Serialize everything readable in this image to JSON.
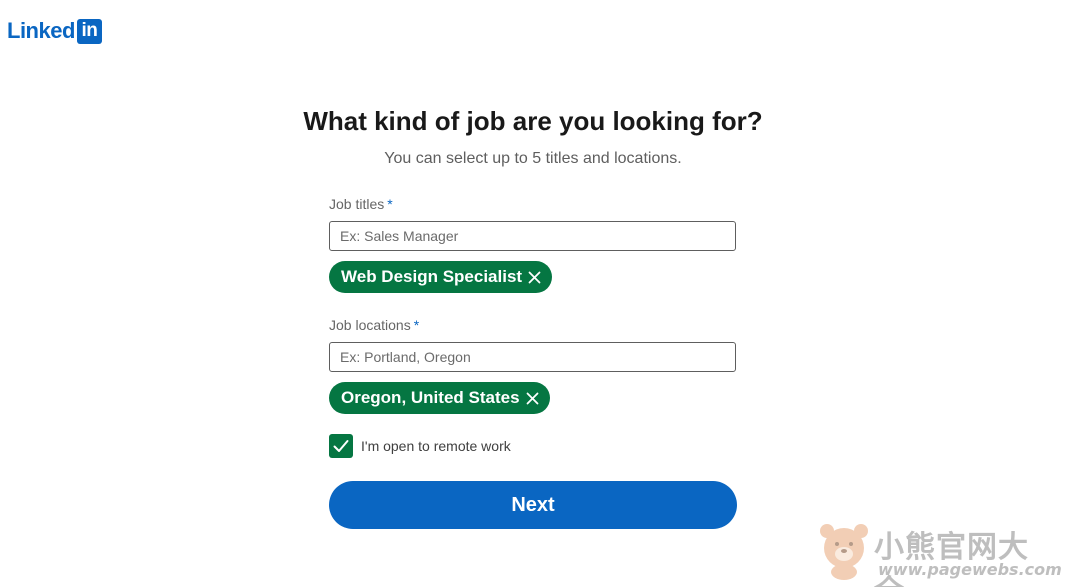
{
  "logo": {
    "word": "Linked",
    "box": "in"
  },
  "heading": "What kind of job are you looking for?",
  "subheading": "You can select up to 5 titles and locations.",
  "job_titles": {
    "label": "Job titles",
    "required_mark": "*",
    "placeholder": "Ex: Sales Manager",
    "value": "",
    "selected": [
      "Web Design Specialist"
    ]
  },
  "job_locations": {
    "label": "Job locations",
    "required_mark": "*",
    "placeholder": "Ex: Portland, Oregon",
    "value": "",
    "selected": [
      "Oregon, United States"
    ]
  },
  "remote": {
    "label": "I'm open to remote work",
    "checked": true
  },
  "next_label": "Next",
  "watermark": {
    "title": "小熊官网大全",
    "url": "www.pagewebs.com"
  },
  "colors": {
    "brand": "#0a66c2",
    "pill": "#057642",
    "heading": "#191919"
  },
  "icons": {
    "remove": "close-icon",
    "checkbox": "checkmark-icon",
    "watermark": "bear-icon"
  }
}
